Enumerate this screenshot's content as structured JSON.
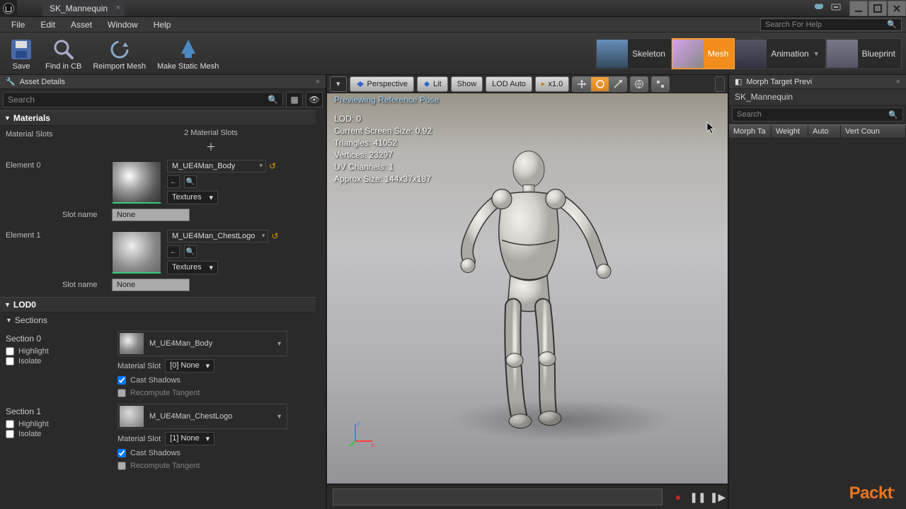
{
  "titlebar": {
    "tab_title": "SK_Mannequin"
  },
  "menubar": {
    "items": [
      "File",
      "Edit",
      "Asset",
      "Window",
      "Help"
    ],
    "help_placeholder": "Search For Help"
  },
  "toolrow": {
    "buttons": [
      "Save",
      "Find in CB",
      "Reimport Mesh",
      "Make Static Mesh"
    ],
    "modes": [
      {
        "label": "Skeleton",
        "active": false
      },
      {
        "label": "Mesh",
        "active": true
      },
      {
        "label": "Animation",
        "active": false,
        "dropdown": true
      },
      {
        "label": "Blueprint",
        "active": false
      }
    ]
  },
  "assetDetails": {
    "tab": "Asset Details",
    "search_placeholder": "Search",
    "materials": {
      "header": "Materials",
      "slots_label": "Material Slots",
      "slot_count": "2 Material Slots",
      "elements": [
        {
          "label": "Element 0",
          "mat_name": "M_UE4Man_Body",
          "textures": "Textures",
          "slot_name_label": "Slot name",
          "slot_name_value": "None"
        },
        {
          "label": "Element 1",
          "mat_name": "M_UE4Man_ChestLogo",
          "textures": "Textures",
          "slot_name_label": "Slot name",
          "slot_name_value": "None"
        }
      ]
    },
    "lod0": {
      "header": "LOD0",
      "sections_label": "Sections",
      "sections": [
        {
          "title": "Section 0",
          "highlight": "Highlight",
          "isolate": "Isolate",
          "mat_name": "M_UE4Man_Body",
          "matslot_label": "Material Slot",
          "matslot_value": "[0] None",
          "cast_shadows": "Cast Shadows",
          "recompute": "Recompute Tangent",
          "cast_checked": true
        },
        {
          "title": "Section 1",
          "highlight": "Highlight",
          "isolate": "Isolate",
          "mat_name": "M_UE4Man_ChestLogo",
          "matslot_label": "Material Slot",
          "matslot_value": "[1] None",
          "cast_shadows": "Cast Shadows",
          "recompute": "Recompute Tangent",
          "cast_checked": true
        }
      ]
    }
  },
  "viewport": {
    "toolbar": {
      "perspective": "Perspective",
      "lit": "Lit",
      "show": "Show",
      "lod_auto": "LOD Auto",
      "speed": "x1.0"
    },
    "status": "Previewing Reference Pose",
    "stats": {
      "lod": "LOD: 0",
      "screen_size": "Current Screen Size: 0.92",
      "triangles": "Triangles: 41052",
      "vertices": "Vertices: 23297",
      "uv": "UV Channels: 1",
      "approx": "Approx Size: 144x37x187"
    }
  },
  "morph": {
    "tab": "Morph Target Previ",
    "asset": "SK_Mannequin",
    "search_placeholder": "Search",
    "headers": [
      "Morph Ta",
      "Weight",
      "Auto",
      "Vert Coun"
    ]
  },
  "watermark": "Packt"
}
